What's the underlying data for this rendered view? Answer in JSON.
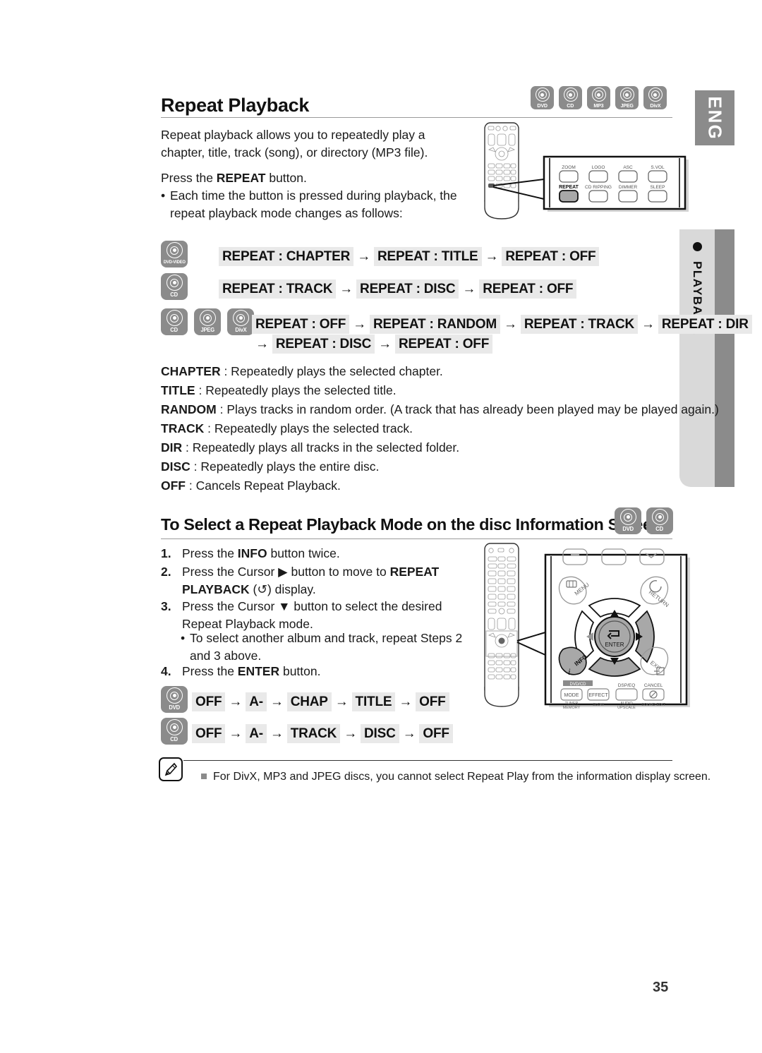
{
  "page": {
    "number": "35",
    "language_tab": "ENG",
    "section_tab": "PLAYBACK"
  },
  "section1": {
    "title": "Repeat Playback",
    "badges": [
      "DVD",
      "CD",
      "MP3",
      "JPEG",
      "DivX"
    ],
    "intro": "Repeat playback allows you to repeatedly play a chapter, title, track (song), or directory (MP3 file).",
    "press_label_pre": "Press the ",
    "press_label_bold": "REPEAT",
    "press_label_post": " button.",
    "bullet": "Each time the button is pressed during playback, the repeat playback mode changes as follows:",
    "flows": [
      {
        "icons": [
          "DVD-VIDEO"
        ],
        "steps": [
          "REPEAT : CHAPTER",
          "REPEAT : TITLE",
          "REPEAT : OFF"
        ]
      },
      {
        "icons": [
          "CD"
        ],
        "steps": [
          "REPEAT : TRACK",
          "REPEAT : DISC",
          "REPEAT : OFF"
        ]
      },
      {
        "icons": [
          "CD",
          "JPEG",
          "DivX"
        ],
        "steps": [
          "REPEAT : OFF",
          "REPEAT : RANDOM",
          "REPEAT : TRACK",
          "REPEAT : DIR",
          "REPEAT : DISC",
          "REPEAT : OFF"
        ]
      }
    ],
    "arrow": "→",
    "definitions": [
      {
        "term": "CHAPTER",
        "desc": " : Repeatedly plays the selected chapter."
      },
      {
        "term": "TITLE",
        "desc": " : Repeatedly plays the selected title."
      },
      {
        "term": "RANDOM",
        "desc": " : Plays tracks in random order. (A track that has already been played may be played again.)"
      },
      {
        "term": "TRACK",
        "desc": " : Repeatedly plays the selected track."
      },
      {
        "term": "DIR",
        "desc": " : Repeatedly plays all tracks in the selected folder."
      },
      {
        "term": "DISC",
        "desc": " : Repeatedly plays the entire disc."
      },
      {
        "term": "OFF",
        "desc": " : Cancels Repeat Playback."
      }
    ]
  },
  "section2": {
    "title": "To Select a Repeat Playback Mode on the disc Information Screen",
    "badges": [
      "DVD",
      "CD"
    ],
    "steps": [
      {
        "num": "1.",
        "text_pre": "Press the ",
        "bold": "INFO",
        "text_post": " button twice."
      },
      {
        "num": "2.",
        "text_pre": "Press the Cursor ▶ button to move to ",
        "bold": "REPEAT PLAYBACK",
        "text_post": " (↺) display."
      },
      {
        "num": "3.",
        "text_pre": "Press the Cursor ▼ button to select the desired Repeat Playback mode.",
        "bold": "",
        "text_post": ""
      },
      {
        "num": "4.",
        "text_pre": "Press the ",
        "bold": "ENTER",
        "text_post": " button."
      }
    ],
    "sub_bullet": "To select another album and track, repeat Steps 2 and 3 above.",
    "flows": [
      {
        "icons": [
          "DVD"
        ],
        "steps": [
          "OFF",
          "A-",
          "CHAP",
          "TITLE",
          "OFF"
        ]
      },
      {
        "icons": [
          "CD"
        ],
        "steps": [
          "OFF",
          "A-",
          "TRACK",
          "DISC",
          "OFF"
        ]
      }
    ]
  },
  "note": {
    "icon": "note-pen-icon",
    "text": "For DivX, MP3 and JPEG discs, you cannot select Repeat Play from the information display screen."
  },
  "remote_top": {
    "buttons_row1": [
      "ZOOM",
      "LOGO",
      "ASC",
      "S.VOL"
    ],
    "buttons_row2": [
      "REPEAT",
      "CD RIPPING",
      "DIMMER",
      "SLEEP"
    ],
    "highlighted": "REPEAT"
  },
  "remote_bottom": {
    "buttons": [
      "MENU",
      "RETURN",
      "ENTER",
      "INFO",
      "EXIT",
      "MODE",
      "EFFECT",
      "DSP/EQ",
      "CANCEL"
    ],
    "sub_labels": [
      "TUNER MEMORY",
      "SLOW",
      "AUDIO UPSCALE",
      "SOUND EDIT"
    ],
    "highlighted": [
      "right-arrow",
      "down-arrow",
      "INFO",
      "ENTER"
    ]
  },
  "colors": {
    "badge_gray": "#8b8b8b",
    "chip_gray": "#e9e9e9",
    "tab_light": "#d9d9d9",
    "rule": "#9a9a9a"
  }
}
